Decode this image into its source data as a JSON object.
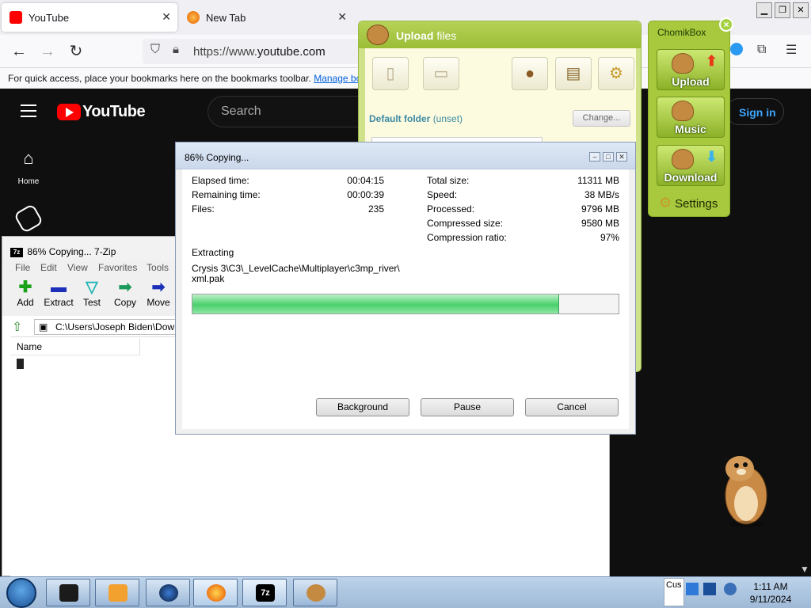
{
  "browser": {
    "tabs": [
      {
        "title": "YouTube",
        "active": true
      },
      {
        "title": "New Tab",
        "active": false
      }
    ],
    "url_prefix": "https://www.",
    "url_domain": "youtube.com",
    "bookmarks_text": "For quick access, place your bookmarks here on the bookmarks toolbar.",
    "bookmarks_link": "Manage bo"
  },
  "youtube": {
    "logo_text": "YouTube",
    "search_placeholder": "Search",
    "signin": "Sign in",
    "home_label": "Home",
    "shorts_label": "Shorts"
  },
  "sevenzip": {
    "title": "86% Copying... 7-Zip",
    "menu": [
      "File",
      "Edit",
      "View",
      "Favorites",
      "Tools"
    ],
    "toolbar": [
      {
        "label": "Add",
        "icon": "plus-icon",
        "color": "#1aa31a"
      },
      {
        "label": "Extract",
        "icon": "minus-icon",
        "color": "#1c2fb8"
      },
      {
        "label": "Test",
        "icon": "check-icon",
        "color": "#1fb3b3"
      },
      {
        "label": "Copy",
        "icon": "arrow-right-icon",
        "color": "#1a9b5a"
      },
      {
        "label": "Move",
        "icon": "arrow-right-icon",
        "color": "#1c2fb8"
      }
    ],
    "path": "C:\\Users\\Joseph Biden\\Down",
    "column_name": "Name"
  },
  "upload": {
    "title_bold": "Upload",
    "title_rest": " files",
    "default_folder_label": "Default folder",
    "default_folder_value": "(unset)",
    "change_button": "Change..."
  },
  "chomikbox": {
    "title": "ChomikBox",
    "close": "×",
    "buttons": [
      "Upload",
      "Music",
      "Download"
    ],
    "settings": "Settings"
  },
  "dialog": {
    "title": "86% Copying...",
    "progress_fraction": 0.86,
    "left": [
      {
        "label": "Elapsed time:",
        "value": "00:04:15"
      },
      {
        "label": "Remaining time:",
        "value": "00:00:39"
      },
      {
        "label": "Files:",
        "value": "235"
      }
    ],
    "right": [
      {
        "label": "Total size:",
        "value": "11311 MB"
      },
      {
        "label": "Speed:",
        "value": "38 MB/s"
      },
      {
        "label": "Processed:",
        "value": "9796 MB"
      },
      {
        "label": "Compressed size:",
        "value": "9580 MB"
      },
      {
        "label": "Compression ratio:",
        "value": "97%"
      }
    ],
    "status": "Extracting",
    "file_line1": "Crysis 3\\C3\\_LevelCache\\Multiplayer\\c3mp_river\\",
    "file_line2": "xml.pak",
    "buttons": {
      "background": "Background",
      "pause": "Pause",
      "cancel": "Cancel"
    }
  },
  "taskbar": {
    "tray_label": "Cus",
    "time": "1:11 AM",
    "date": "9/11/2024"
  }
}
